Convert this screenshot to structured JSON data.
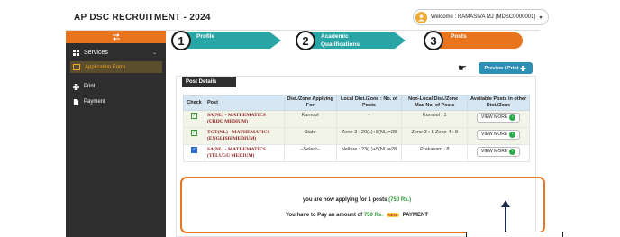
{
  "header": {
    "app_title": "AP DSC RECRUITMENT - 2024",
    "welcome": "Welcome : RAMASIVA MJ (MDSC0000001)",
    "caret": "▾"
  },
  "sidebar": {
    "items": [
      {
        "label": "Services",
        "icon": "grid-icon"
      },
      {
        "label": "Application Form",
        "icon": "form-icon"
      },
      {
        "label": "Print",
        "icon": "printer-icon"
      },
      {
        "label": "Payment",
        "icon": "file-icon"
      }
    ]
  },
  "steps": [
    {
      "num": "1",
      "label": "Profile",
      "color": "#2aa5a5"
    },
    {
      "num": "2",
      "label": "Academic\nQualifications",
      "color": "#2aa5a5"
    },
    {
      "num": "3",
      "label": "Posts",
      "color": "#e8741e"
    }
  ],
  "preview_label": "Preview / Print",
  "post_details": {
    "title": "Post Details",
    "columns": [
      "Check",
      "Post",
      "Dist./Zone Applying For",
      "Local Dist./Zone : No. of Posts",
      "Non-Local Dist./Zone : Max No. of Posts",
      "Available Posts in other Dist./Zone"
    ],
    "rows": [
      {
        "check": "✓",
        "post": "SA(NL) - MATHEMATICS (URDU MEDIUM)",
        "applying": "Kurnool",
        "local": "-",
        "nonlocal": "Kurnool : 1",
        "action": "VIEW MORE"
      },
      {
        "check": "✓",
        "post": "TGT(NL) - MATHEMATICS (ENGLISH MEDIUM)",
        "applying": "State",
        "local": "Zone-3 : 20(L)+8(NL)=28",
        "nonlocal": "Zone-3 : 8 Zone-4 : 8",
        "action": "VIEW MORE"
      },
      {
        "check": "✓",
        "post": "SA(NL) - MATHEMATICS (TELUGU MEDIUM)",
        "applying": "--Select--",
        "local": "Nellore : 23(L)+5(NL)=28",
        "nonlocal": "Prakasam : 8",
        "action": "VIEW MORE"
      }
    ]
  },
  "summary": {
    "line1_prefix": "you are now applying for 1 posts",
    "line1_value": "(750 Rs.)",
    "line2_prefix": "You have to Pay an amount of",
    "line2_value": "750 Rs.",
    "new_badge": "NEW",
    "payment_label": "PAYMENT"
  },
  "colors": {
    "accent_orange": "#e8741e",
    "teal": "#2aa5a5",
    "sidebar_dark": "#2e2e2e",
    "table_header": "#d6e6f3",
    "post_text": "#8b1a1a",
    "green": "#2e9a3a"
  }
}
